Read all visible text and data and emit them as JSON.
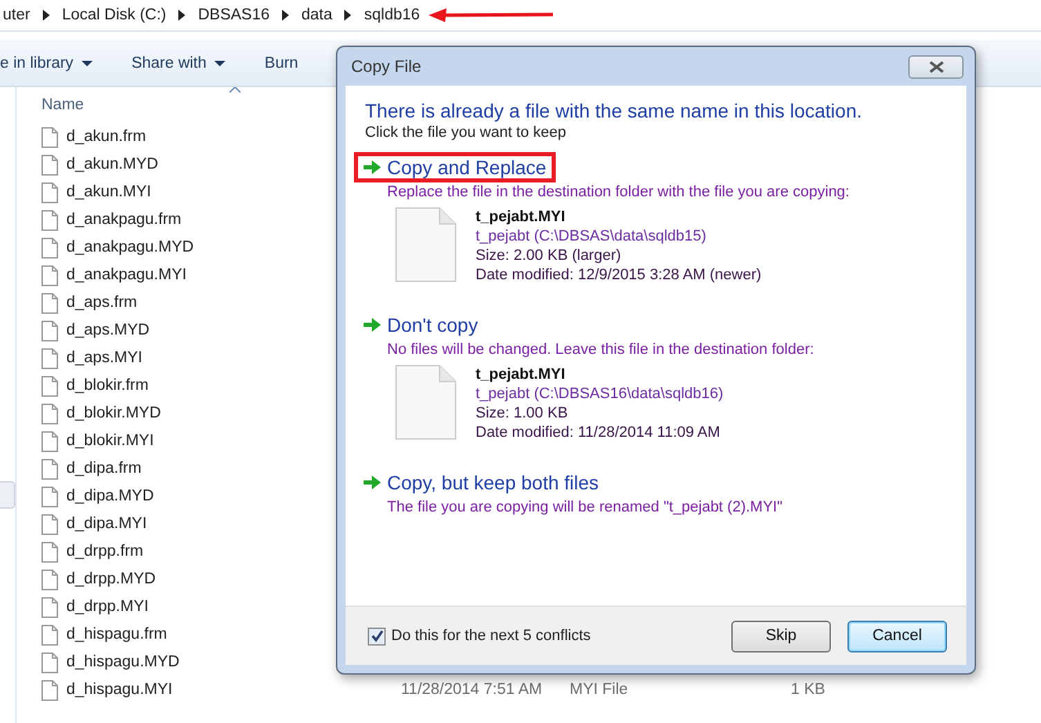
{
  "breadcrumb": [
    {
      "label": "uter",
      "arrow_annotation": false
    },
    {
      "label": "Local Disk (C:)",
      "arrow_annotation": false
    },
    {
      "label": "DBSAS16",
      "arrow_annotation": false
    },
    {
      "label": "data",
      "arrow_annotation": false
    },
    {
      "label": "sqldb16",
      "arrow_annotation": true
    }
  ],
  "toolbar": [
    {
      "label": "e in library",
      "dropdown": true
    },
    {
      "label": "Share with",
      "dropdown": true
    },
    {
      "label": "Burn",
      "dropdown": false
    }
  ],
  "column_header": "Name",
  "files": [
    {
      "name": "d_akun.frm"
    },
    {
      "name": "d_akun.MYD"
    },
    {
      "name": "d_akun.MYI"
    },
    {
      "name": "d_anakpagu.frm"
    },
    {
      "name": "d_anakpagu.MYD"
    },
    {
      "name": "d_anakpagu.MYI"
    },
    {
      "name": "d_aps.frm"
    },
    {
      "name": "d_aps.MYD"
    },
    {
      "name": "d_aps.MYI"
    },
    {
      "name": "d_blokir.frm"
    },
    {
      "name": "d_blokir.MYD"
    },
    {
      "name": "d_blokir.MYI"
    },
    {
      "name": "d_dipa.frm"
    },
    {
      "name": "d_dipa.MYD"
    },
    {
      "name": "d_dipa.MYI"
    },
    {
      "name": "d_drpp.frm"
    },
    {
      "name": "d_drpp.MYD"
    },
    {
      "name": "d_drpp.MYI"
    },
    {
      "name": "d_hispagu.frm"
    },
    {
      "name": "d_hispagu.MYD"
    },
    {
      "name": "d_hispagu.MYI",
      "modified": "11/28/2014 7:51 AM",
      "type": "MYI File",
      "size": "1 KB"
    }
  ],
  "dialog": {
    "title": "Copy File",
    "heading": "There is already a file with the same name in this location.",
    "instruction": "Click the file you want to keep",
    "options": [
      {
        "title": "Copy and Replace",
        "description": "Replace the file in the destination folder with the file you are copying:",
        "highlighted": true,
        "file": {
          "name": "t_pejabt.MYI",
          "path": "t_pejabt (C:\\DBSAS\\data\\sqldb15)",
          "size": "Size: 2.00 KB (larger)",
          "modified": "Date modified: 12/9/2015 3:28 AM (newer)"
        }
      },
      {
        "title": "Don't copy",
        "description": "No files will be changed. Leave this file in the destination folder:",
        "highlighted": false,
        "file": {
          "name": "t_pejabt.MYI",
          "path": "t_pejabt (C:\\DBSAS16\\data\\sqldb16)",
          "size": "Size: 1.00 KB",
          "modified": "Date modified: 11/28/2014 11:09 AM"
        }
      },
      {
        "title": "Copy, but keep both files",
        "description": "The file you are copying will be renamed \"t_pejabt (2).MYI\"",
        "highlighted": false
      }
    ],
    "checkbox": {
      "label": "Do this for the next 5 conflicts",
      "checked": true
    },
    "buttons": [
      {
        "label": "Skip",
        "default": false
      },
      {
        "label": "Cancel",
        "default": true
      }
    ]
  }
}
